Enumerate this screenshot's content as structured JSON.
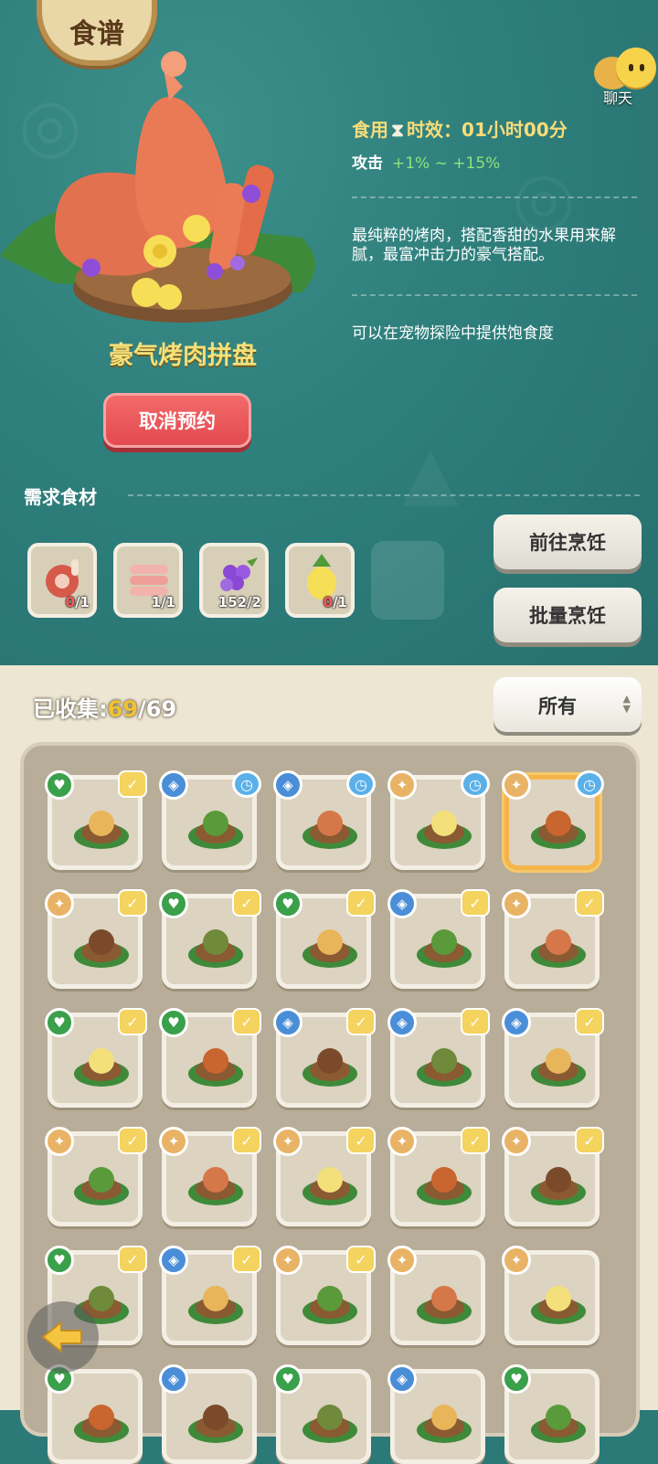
{
  "header": {
    "title": "食谱",
    "chat_label": "聊天"
  },
  "recipe": {
    "name": "豪气烤肉拼盘",
    "cancel_label": "取消预约",
    "effect_prefix": "食用",
    "effect_text": "时效：01小时00分",
    "attack_label": "攻击",
    "attack_range": "+1% ~  +15%",
    "description": "最纯粹的烤肉，搭配香甜的水果用来解腻，最富冲击力的豪气搭配。",
    "note": "可以在宠物探险中提供饱食度"
  },
  "ingredients": {
    "title": "需求食材",
    "items": [
      {
        "name": "meat-leg",
        "have": "0",
        "need": "/1"
      },
      {
        "name": "bacon",
        "have": "1",
        "need": "/1"
      },
      {
        "name": "grapes",
        "have": "152",
        "need": "/2"
      },
      {
        "name": "pineapple",
        "have": "0",
        "need": "/1"
      }
    ]
  },
  "actions": {
    "goto_cook": "前往烹饪",
    "batch_cook": "批量烹饪"
  },
  "collection": {
    "label": "已收集:",
    "count": "69",
    "total": "/69",
    "filter": "所有"
  },
  "colors": {
    "accent": "#f2c230",
    "cancel": "#e24a50",
    "heart": "#3aa04a",
    "shield": "#4b8ed8",
    "axe": "#e9b366"
  },
  "grid": [
    {
      "tag": "heart",
      "badge": "check-clock"
    },
    {
      "tag": "shield",
      "badge": "clock"
    },
    {
      "tag": "shield",
      "badge": "clock"
    },
    {
      "tag": "axe",
      "badge": "clock"
    },
    {
      "tag": "axe",
      "badge": "clock"
    },
    {
      "tag": "axe",
      "badge": "check"
    },
    {
      "tag": "heart",
      "badge": "check"
    },
    {
      "tag": "heart",
      "badge": "check"
    },
    {
      "tag": "shield",
      "badge": "check"
    },
    {
      "tag": "axe",
      "badge": "check"
    },
    {
      "tag": "heart",
      "badge": "check"
    },
    {
      "tag": "heart",
      "badge": "check"
    },
    {
      "tag": "shield",
      "badge": "check"
    },
    {
      "tag": "shield",
      "badge": "check"
    },
    {
      "tag": "shield",
      "badge": "check"
    },
    {
      "tag": "axe",
      "badge": "check"
    },
    {
      "tag": "axe",
      "badge": "check"
    },
    {
      "tag": "axe",
      "badge": "check"
    },
    {
      "tag": "axe",
      "badge": "check"
    },
    {
      "tag": "axe",
      "badge": "check"
    },
    {
      "tag": "heart",
      "badge": "check"
    },
    {
      "tag": "shield",
      "badge": "check"
    },
    {
      "tag": "axe",
      "badge": "check"
    },
    {
      "tag": "axe",
      "badge": "none"
    },
    {
      "tag": "axe",
      "badge": "none"
    },
    {
      "tag": "heart",
      "badge": "none"
    },
    {
      "tag": "shield",
      "badge": "none"
    },
    {
      "tag": "heart",
      "badge": "none"
    },
    {
      "tag": "shield",
      "badge": "none"
    },
    {
      "tag": "heart",
      "badge": "none"
    }
  ]
}
